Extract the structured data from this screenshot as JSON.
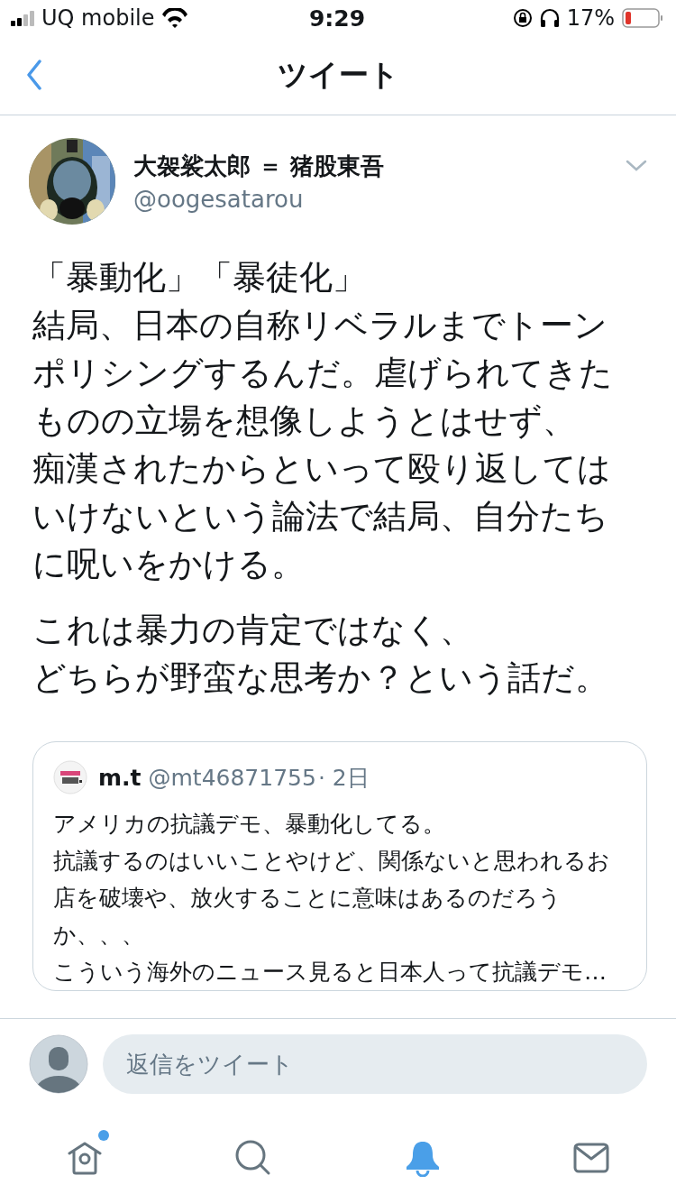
{
  "status_bar": {
    "carrier": "UQ mobile",
    "time": "9:29",
    "battery": "17%"
  },
  "nav": {
    "title": "ツイート"
  },
  "tweet": {
    "display_name": "大袈裟太郎 ＝ 猪股東吾",
    "handle": "@oogesatarou",
    "paragraphs": [
      [
        "「暴動化」「暴徒化」",
        "結局、日本の自称リベラルまでトーン",
        "ポリシングするんだ。虐げられてきた",
        "ものの立場を想像しようとはせず、",
        "痴漢されたからといって殴り返しては",
        "いけないという論法で結局、自分たち",
        "に呪いをかける。"
      ],
      [
        "これは暴力の肯定ではなく、",
        "どちらが野蛮な思考か？という話だ。"
      ]
    ],
    "quoted": {
      "display_name": "m.t",
      "handle": "@mt46871755",
      "time": "· 2日",
      "text_lines": [
        "アメリカの抗議デモ、暴動化してる。",
        "抗議するのはいいことやけど、関係ないと思われるお",
        "店を破壊や、放火することに意味はあるのだろう",
        "か、、、",
        "こういう海外のニュース見ると日本人って抗議デモ…"
      ]
    }
  },
  "reply": {
    "placeholder": "返信をツイート"
  },
  "tabs": [
    {
      "kind": "home",
      "selected": false,
      "has_notification": true
    },
    {
      "kind": "search",
      "selected": false,
      "has_notification": false
    },
    {
      "kind": "notifications",
      "selected": true,
      "has_notification": false
    },
    {
      "kind": "messages",
      "selected": false,
      "has_notification": false
    }
  ]
}
